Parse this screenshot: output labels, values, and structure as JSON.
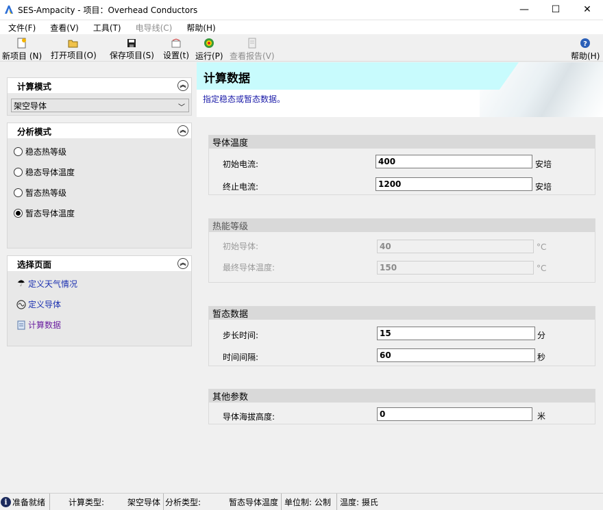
{
  "window": {
    "title": "SES-Ampacity - 项目：Overhead Conductors",
    "minimize": "—",
    "maximize": "☐",
    "close": "✕"
  },
  "menu": [
    {
      "label": "文件(F)",
      "disabled": false
    },
    {
      "label": "查看(V)",
      "disabled": false
    },
    {
      "label": "工具(T)",
      "disabled": false
    },
    {
      "label": "电导线(C)",
      "disabled": true
    },
    {
      "label": "帮助(H)",
      "disabled": false
    }
  ],
  "toolbar": {
    "new_project": "新项目 (N)",
    "open_project": "打开项目(O)",
    "save_project": "保存项目(S)",
    "settings": "设置(t)",
    "run": "运行(P)",
    "view_report": "查看报告(V)",
    "help": "帮助(H)"
  },
  "left": {
    "calc_mode": {
      "title": "计算模式",
      "selected": "架空导体"
    },
    "analysis_mode": {
      "title": "分析模式",
      "options": [
        "稳态热等级",
        "稳态导体温度",
        "暂态热等级",
        "暂态导体温度"
      ],
      "selected_index": 3
    },
    "select_page": {
      "title": "选择页面",
      "links": [
        "定义天气情况",
        "定义导体",
        "计算数据"
      ]
    }
  },
  "main": {
    "banner_title": "计算数据",
    "banner_subtitle": "指定稳态或暂态数据。",
    "conductor_temp": {
      "title": "导体温度",
      "initial_current_label": "初始电流:",
      "initial_current_value": "400",
      "initial_current_unit": "安培",
      "final_current_label": "终止电流:",
      "final_current_value": "1200",
      "final_current_unit": "安培"
    },
    "thermal_rating": {
      "title": "热能等级",
      "initial_conductor_label": "初始导体:",
      "initial_conductor_value": "40",
      "initial_conductor_unit": "°C",
      "final_temp_label": "最终导体温度:",
      "final_temp_value": "150",
      "final_temp_unit": "°C"
    },
    "transient": {
      "title": "暂态数据",
      "step_label": "步长时间:",
      "step_value": "15",
      "step_unit": "分",
      "interval_label": "时间间隔:",
      "interval_value": "60",
      "interval_unit": "秒"
    },
    "other": {
      "title": "其他参数",
      "altitude_label": "导体海拔高度:",
      "altitude_value": "0",
      "altitude_unit": "米"
    }
  },
  "status": {
    "ready": "准备就绪",
    "calc_type_label": "计算类型:",
    "calc_type_value": "架空导体",
    "analysis_type_label": "分析类型:",
    "analysis_type_value": "暂态导体温度",
    "unit_system": "单位制: 公制",
    "temperature": "温度: 摄氏"
  },
  "colors": {
    "banner_accent": "#c8fbfd",
    "link": "#1a2fb0",
    "visited_link": "#6a1fa0",
    "subtitle": "#1a1aa8"
  }
}
